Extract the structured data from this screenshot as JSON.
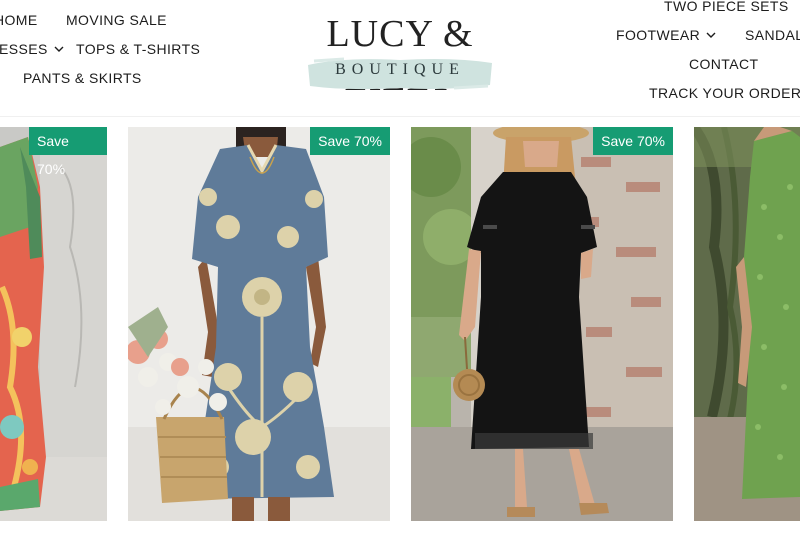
{
  "nav_left": {
    "home": "HOME",
    "moving_sale": "MOVING SALE",
    "dresses": "DRESSES",
    "tops": "TOPS & T-SHIRTS",
    "pants": "PANTS & SKIRTS"
  },
  "nav_right": {
    "two_piece": "TWO PIECE SETS",
    "footwear": "FOOTWEAR",
    "sandals": "SANDALS",
    "contact": "CONTACT",
    "track": "TRACK YOUR ORDER"
  },
  "logo": {
    "main": "LUCY & LILLY",
    "sub": "BOUTIQUE"
  },
  "products": [
    {
      "badge": "Save 70%"
    },
    {
      "badge": "Save 70%"
    },
    {
      "badge": "Save 70%"
    },
    {
      "badge": ""
    }
  ],
  "colors": {
    "badge": "#169c73",
    "logo_swash": "#cfe3df"
  },
  "icons": {
    "dropdown": "chevron-down-icon"
  }
}
